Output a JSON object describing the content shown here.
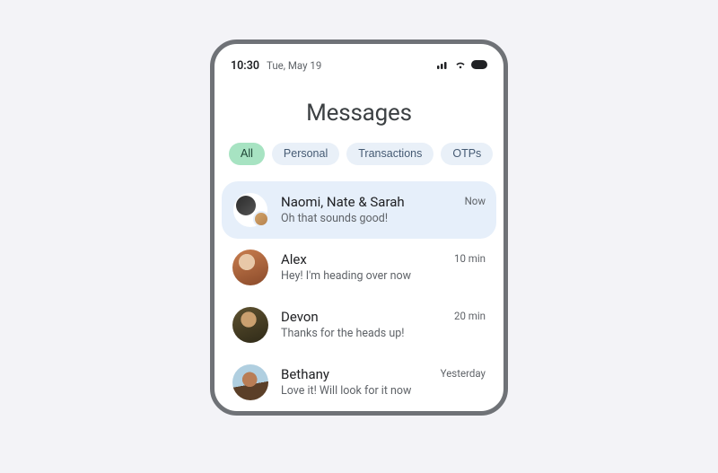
{
  "status": {
    "time": "10:30",
    "date": "Tue, May 19"
  },
  "header": {
    "title": "Messages"
  },
  "tabs": [
    {
      "label": "All",
      "active": true
    },
    {
      "label": "Personal",
      "active": false
    },
    {
      "label": "Transactions",
      "active": false
    },
    {
      "label": "OTPs",
      "active": false
    }
  ],
  "conversations": [
    {
      "title": "Naomi, Nate & Sarah",
      "preview": "Oh that sounds good!",
      "time": "Now",
      "highlight": true,
      "avatar": "group"
    },
    {
      "title": "Alex",
      "preview": "Hey! I'm heading over now",
      "time": "10 min",
      "highlight": false,
      "avatar": "alex"
    },
    {
      "title": "Devon",
      "preview": "Thanks for the heads up!",
      "time": "20 min",
      "highlight": false,
      "avatar": "devon"
    },
    {
      "title": "Bethany",
      "preview": "Love it! Will look for it now",
      "time": "Yesterday",
      "highlight": false,
      "avatar": "bethany"
    }
  ]
}
